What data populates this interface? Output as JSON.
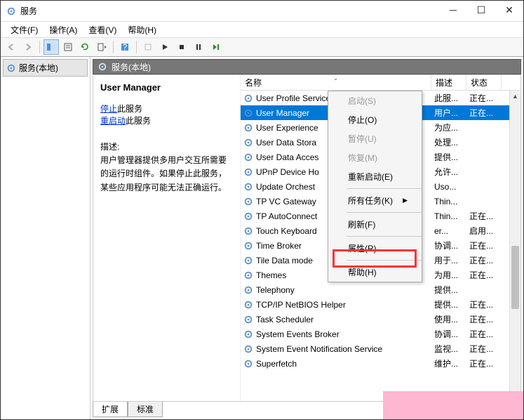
{
  "window": {
    "title": "服务"
  },
  "menu": {
    "file": "文件(F)",
    "action": "操作(A)",
    "view": "查看(V)",
    "help": "帮助(H)"
  },
  "tree": {
    "root": "服务(本地)"
  },
  "ext_header": "服务(本地)",
  "detail": {
    "title": "User Manager",
    "stop_link": "停止",
    "stop_suffix": "此服务",
    "restart_link": "重启动",
    "restart_suffix": "此服务",
    "desc_label": "描述:",
    "desc_text": "用户管理器提供多用户交互所需要的运行时组件。如果停止此服务，某些应用程序可能无法正确运行。"
  },
  "columns": {
    "name": "名称",
    "desc": "描述",
    "status": "状态"
  },
  "rows": [
    {
      "name": "User Profile Service",
      "desc": "此服...",
      "status": "正在..."
    },
    {
      "name": "User Manager",
      "desc": "用户...",
      "status": "正在...",
      "selected": true
    },
    {
      "name": "User Experience",
      "desc": "为应...",
      "status": ""
    },
    {
      "name": "User Data Stora",
      "desc": "处理...",
      "status": ""
    },
    {
      "name": "User Data Acces",
      "desc": "提供...",
      "status": ""
    },
    {
      "name": "UPnP Device Ho",
      "desc": "允许...",
      "status": ""
    },
    {
      "name": "Update Orchest",
      "desc": "Uso...",
      "status": ""
    },
    {
      "name": "TP VC Gateway",
      "desc": "Thin...",
      "status": ""
    },
    {
      "name": "TP AutoConnect",
      "desc": "Thin...",
      "status": "正在..."
    },
    {
      "name": "Touch Keyboard",
      "desc": "er...",
      "status": "启用..."
    },
    {
      "name": "Time Broker",
      "desc": "协调...",
      "status": "正在..."
    },
    {
      "name": "Tile Data mode",
      "desc": "用于...",
      "status": "正在..."
    },
    {
      "name": "Themes",
      "desc": "为用...",
      "status": "正在..."
    },
    {
      "name": "Telephony",
      "desc": "提供...",
      "status": ""
    },
    {
      "name": "TCP/IP NetBIOS Helper",
      "desc": "提供...",
      "status": "正在..."
    },
    {
      "name": "Task Scheduler",
      "desc": "使用...",
      "status": "正在..."
    },
    {
      "name": "System Events Broker",
      "desc": "协调...",
      "status": "正在..."
    },
    {
      "name": "System Event Notification Service",
      "desc": "监视...",
      "status": "正在..."
    },
    {
      "name": "Superfetch",
      "desc": "维护...",
      "status": "正在..."
    }
  ],
  "context_menu": {
    "start": "启动(S)",
    "stop": "停止(O)",
    "pause": "暂停(U)",
    "resume": "恢复(M)",
    "restart": "重新启动(E)",
    "all_tasks": "所有任务(K)",
    "refresh": "刷新(F)",
    "properties": "属性(R)",
    "help": "帮助(H)"
  },
  "tabs": {
    "extended": "扩展",
    "standard": "标准"
  }
}
